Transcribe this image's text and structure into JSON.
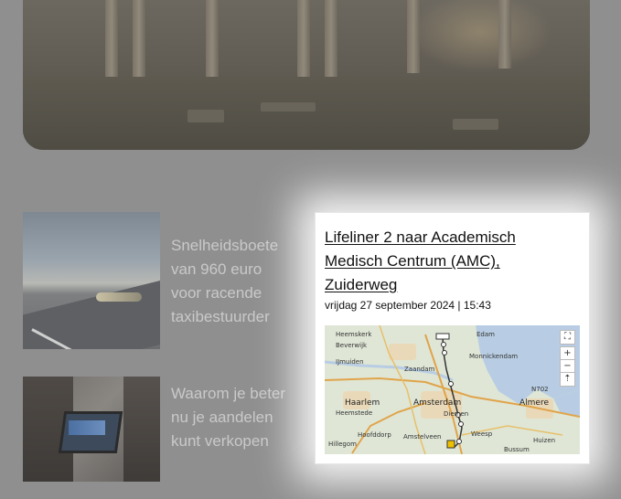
{
  "hero": {
    "icon": "ruins-photo"
  },
  "articles": [
    {
      "title": "Snelheidsboete van 960 euro voor racende taxibestuurder",
      "thumb": "car-on-road-photo"
    },
    {
      "title": "Waarom je beter nu je aandelen kunt verkopen",
      "thumb": "laptop-meeting-photo"
    }
  ],
  "popup": {
    "title": "Lifeliner 2 naar Academisch Medisch Centrum (AMC), Zuiderweg",
    "date": "vrijdag 27 september 2024 | 15:43",
    "map": {
      "controls": {
        "fullscreen": "⛶",
        "zoom_in": "+",
        "zoom_out": "−",
        "reset": "⇡"
      },
      "labels": {
        "heemskerk": "Heemskerk",
        "beverwijk": "Beverwijk",
        "ijmuiden": "IJmuiden",
        "zaandam": "Zaandam",
        "edam": "Edam",
        "monnickendam": "Monnickendam",
        "haarlem": "Haarlem",
        "amsterdam": "Amsterdam",
        "almere": "Almere",
        "heemstede": "Heemstede",
        "diemen": "Diemen",
        "weesp": "Weesp",
        "amstelveen": "Amstelveen",
        "hoofddorp": "Hoofddorp",
        "hillegom": "Hillegom",
        "bussum": "Bussum",
        "huizen": "Huizen",
        "lelystad_road": "N702"
      }
    }
  },
  "colors": {
    "overlay": "#8f8f8f",
    "card_bg": "#ffffff",
    "route": "#333333",
    "water": "#b8cde3",
    "land": "#e6ead8"
  }
}
